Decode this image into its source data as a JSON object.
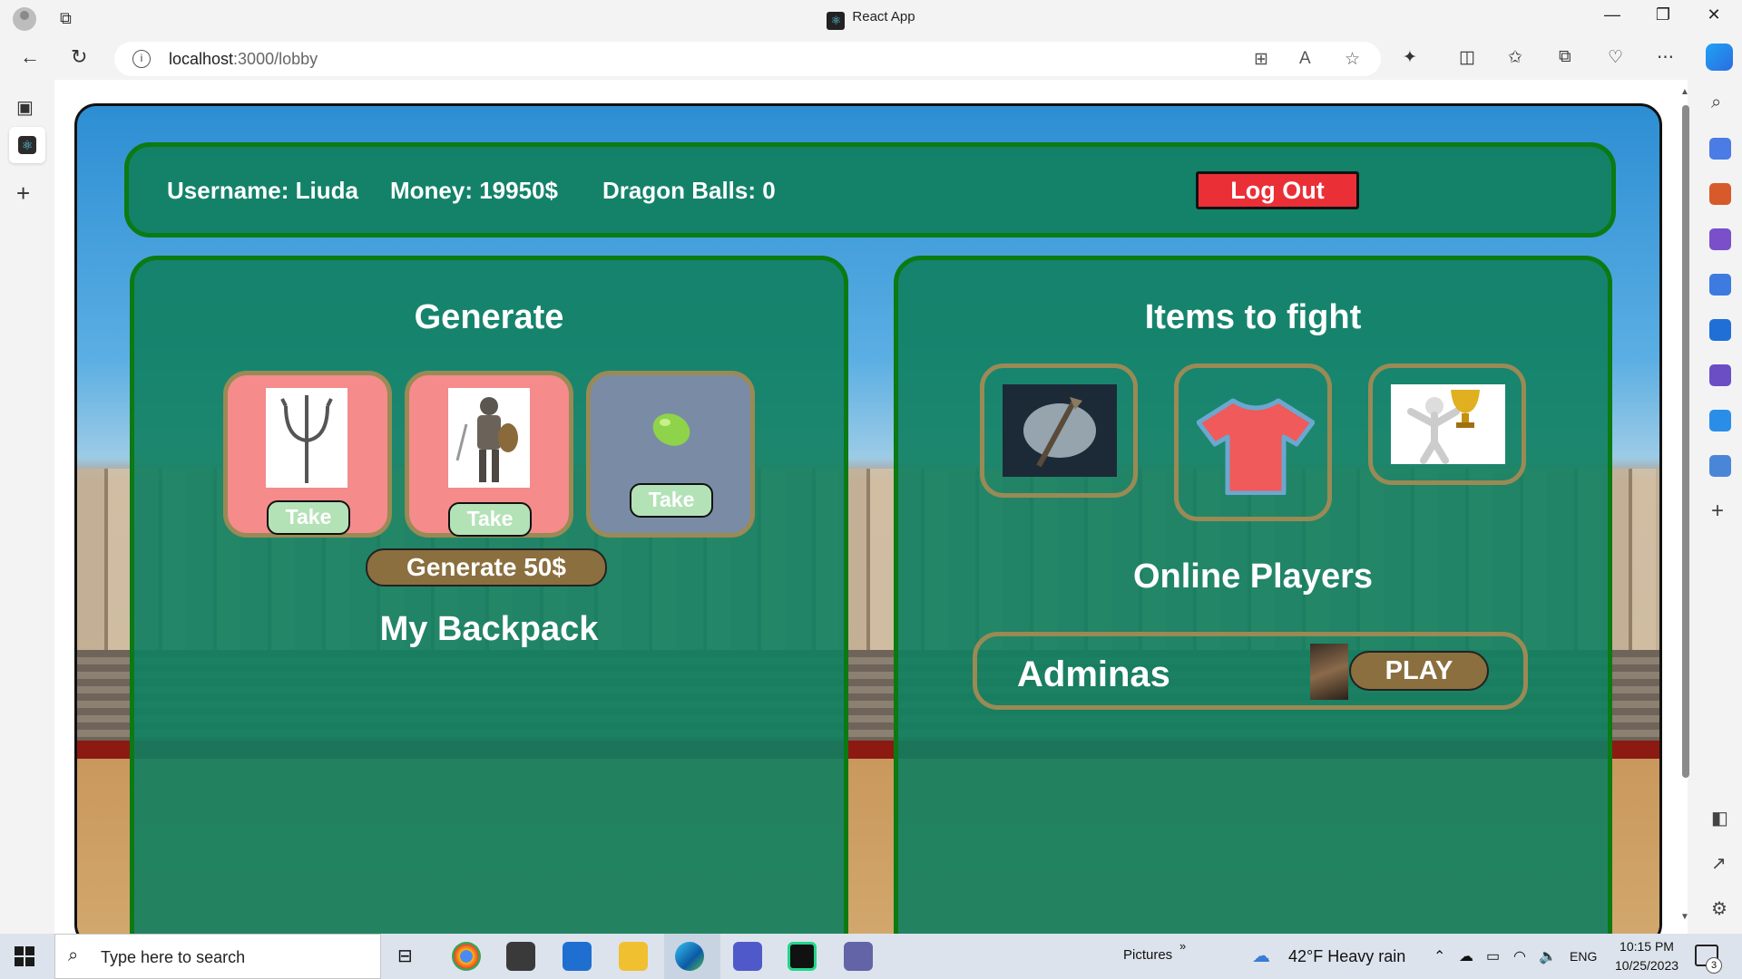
{
  "browser": {
    "window_title": "React App",
    "url_host": "localhost",
    "url_path": ":3000/lobby"
  },
  "header": {
    "username": "Username: Liuda",
    "money": "Money: 19950$",
    "dragon_balls": "Dragon Balls: 0",
    "logout_label": "Log Out"
  },
  "generate": {
    "title": "Generate",
    "cards": [
      {
        "item": "trident",
        "take_label": "Take",
        "bg": "#f58b8b"
      },
      {
        "item": "armored-knight",
        "take_label": "Take",
        "bg": "#f58b8b"
      },
      {
        "item": "green-bean",
        "take_label": "Take",
        "bg": "#7a8ba6"
      }
    ],
    "generate_label": "Generate 50$",
    "backpack_title": "My Backpack"
  },
  "fight": {
    "title": "Items to fight",
    "items": [
      "sword-in-stone",
      "red-tshirt",
      "trophy-figure"
    ],
    "online_title": "Online Players",
    "players": [
      {
        "name": "Adminas",
        "play_label": "PLAY"
      }
    ]
  },
  "taskbar": {
    "search_placeholder": "Type here to search",
    "pictures_label": "Pictures",
    "weather": "42°F  Heavy rain",
    "lang": "ENG",
    "time": "10:15 PM",
    "date": "10/25/2023",
    "notif_count": "3"
  },
  "colors": {
    "panel_green": "#108060",
    "border_green": "#0b7a12",
    "gold_border": "#9a8a55",
    "logout_red": "#ea2f37",
    "brown_button": "#8b6f3f"
  }
}
